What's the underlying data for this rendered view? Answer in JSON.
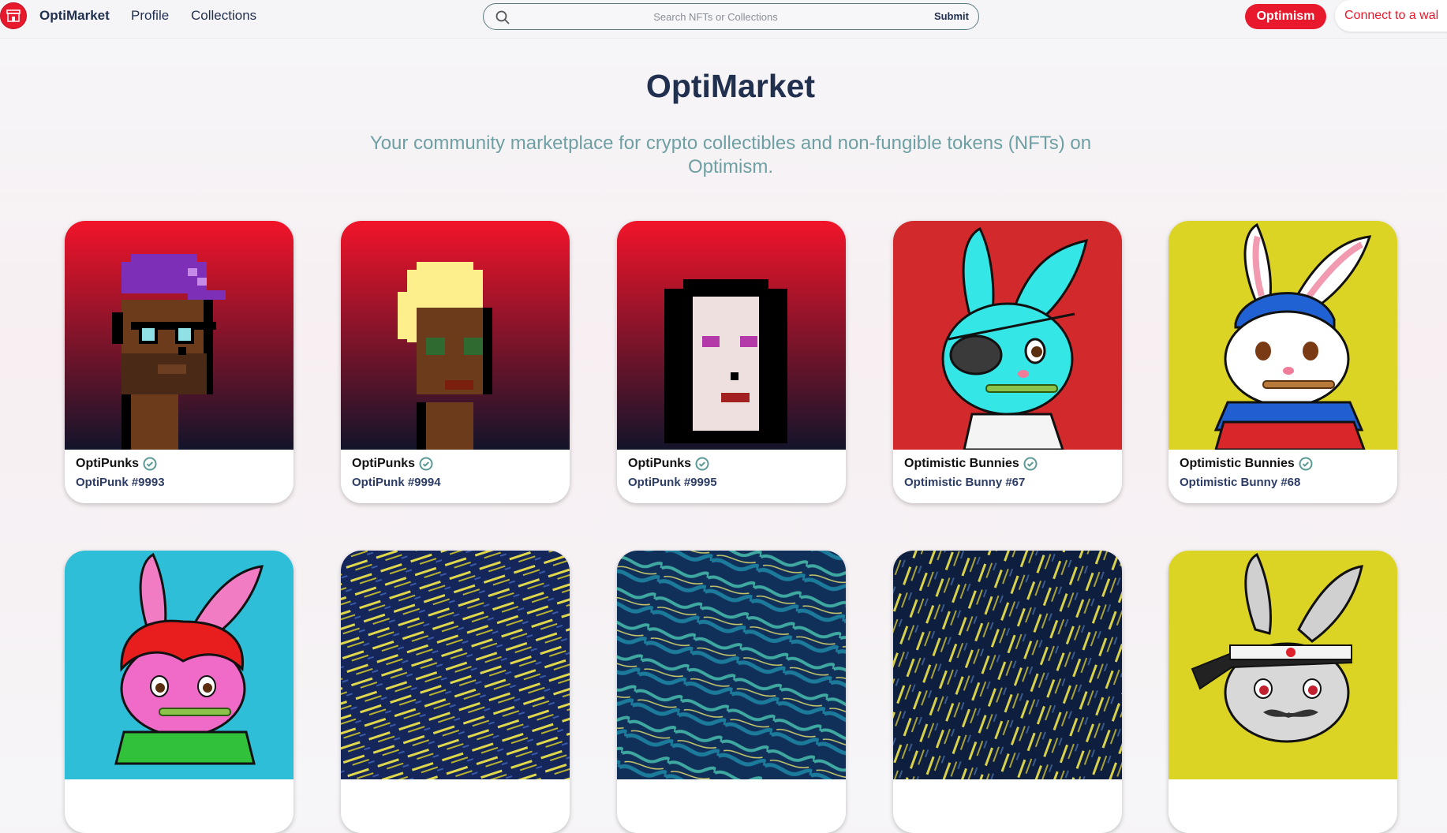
{
  "header": {
    "brand": "OptiMarket",
    "nav": [
      "Profile",
      "Collections"
    ],
    "search": {
      "placeholder": "Search NFTs or Collections",
      "submit_label": "Submit"
    },
    "network_label": "Optimism",
    "connect_label": "Connect to a wal"
  },
  "hero": {
    "title": "OptiMarket",
    "subtitle": "Your community marketplace for crypto collectibles and non-fungible tokens (NFTs) on Optimism."
  },
  "colors": {
    "accent": "#e8192c",
    "text_dark": "#22304f",
    "subtitle": "#6ea0a3",
    "token_text": "#2d3d66"
  },
  "cards": [
    {
      "collection": "OptiPunks",
      "token": "OptiPunk #9993",
      "art": "punk-purple-cap"
    },
    {
      "collection": "OptiPunks",
      "token": "OptiPunk #9994",
      "art": "punk-blonde"
    },
    {
      "collection": "OptiPunks",
      "token": "OptiPunk #9995",
      "art": "punk-dark-hair"
    },
    {
      "collection": "Optimistic Bunnies",
      "token": "Optimistic Bunny #67",
      "art": "bunny-cyan-eyepatch"
    },
    {
      "collection": "Optimistic Bunnies",
      "token": "Optimistic Bunny #68",
      "art": "bunny-white-blue-cap"
    },
    {
      "collection": "",
      "token": "",
      "art": "bunny-pink-red-hair"
    },
    {
      "collection": "",
      "token": "",
      "art": "abstract-yellow-strokes"
    },
    {
      "collection": "",
      "token": "",
      "art": "abstract-teal-swirls"
    },
    {
      "collection": "",
      "token": "",
      "art": "abstract-yellow-strokes"
    },
    {
      "collection": "",
      "token": "",
      "art": "bunny-grey-headband"
    }
  ]
}
